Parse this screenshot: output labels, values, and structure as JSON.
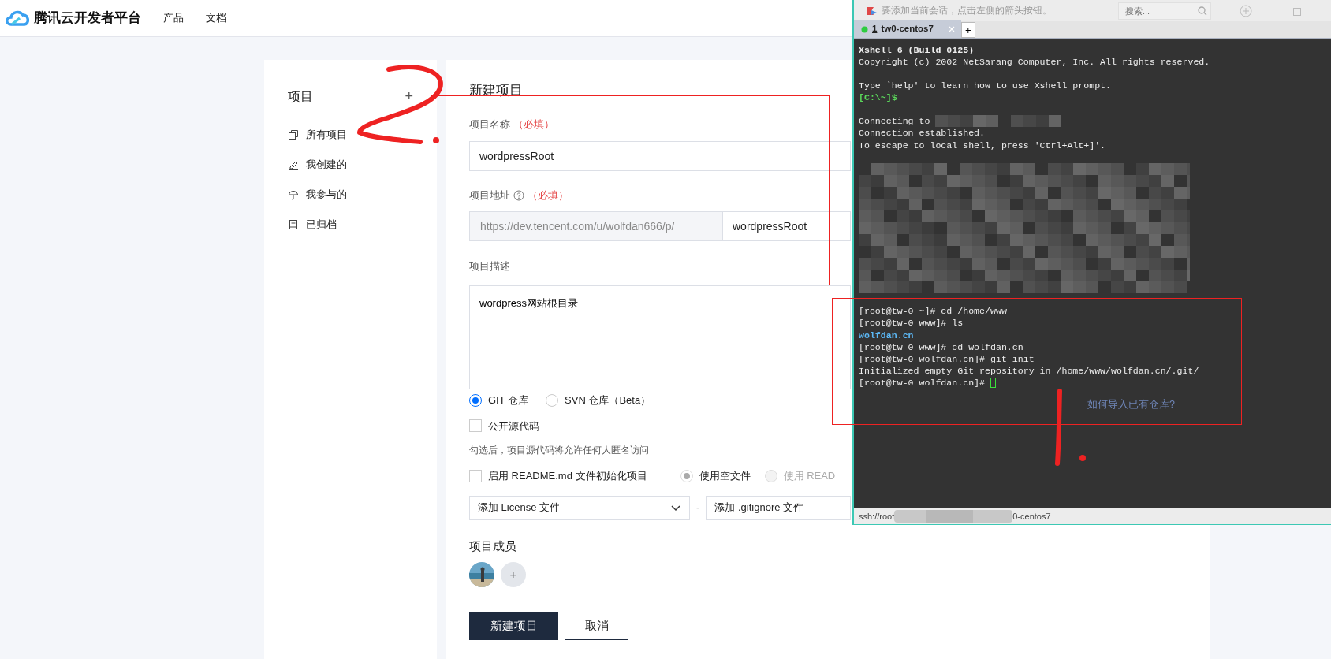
{
  "header": {
    "logo_text": "腾讯云开发者平台",
    "nav": [
      {
        "label": "产品"
      },
      {
        "label": "文档"
      }
    ]
  },
  "sidebar": {
    "title": "项目",
    "add": "+",
    "items": [
      {
        "label": "所有项目",
        "kind": "copy"
      },
      {
        "label": "我创建的",
        "kind": "pencil"
      },
      {
        "label": "我参与的",
        "kind": "umbrella"
      },
      {
        "label": "已归档",
        "kind": "archive"
      }
    ]
  },
  "form": {
    "title": "新建项目",
    "name_label": "项目名称",
    "name_required": "（必填）",
    "name_value": "wordpressRoot",
    "url_label": "项目地址",
    "url_required": "（必填）",
    "url_prefix": "https://dev.tencent.com/u/wolfdan666/p/",
    "url_value": "wordpressRoot",
    "desc_label": "项目描述",
    "desc_value": "wordpress网站根目录",
    "repo_types": [
      {
        "label": "GIT 仓库",
        "selected": true
      },
      {
        "label": "SVN 仓库（Beta）",
        "selected": false
      }
    ],
    "public": {
      "label": "公开源代码",
      "checked": false
    },
    "public_hint": "勾选后，项目源代码将允许任何人匿名访问",
    "readme": {
      "label": "启用 README.md 文件初始化项目",
      "checked": false
    },
    "readme_options": [
      {
        "label": "使用空文件",
        "selected": true,
        "disabled": false
      },
      {
        "label": "使用 READ",
        "selected": false,
        "disabled": true
      }
    ],
    "license_select": "添加 License 文件",
    "separator": "-",
    "gitignore_select": "添加 .gitignore 文件",
    "members_label": "项目成员",
    "add_member": "+",
    "buttons": [
      {
        "label": "新建项目",
        "kind": "primary"
      },
      {
        "label": "取消",
        "kind": "secondary"
      }
    ]
  },
  "xshell": {
    "hint": "要添加当前会话，点击左侧的箭头按钮。",
    "search_placeholder": "搜索...",
    "tabs": [
      {
        "number": "1",
        "label": "tw0-centos7",
        "selected": true
      }
    ],
    "new_tab": "+",
    "lines": [
      {
        "kind": "heading",
        "text": "Xshell 6 (Build 0125)"
      },
      {
        "kind": "text",
        "text": "Copyright (c) 2002 NetSarang Computer, Inc. All rights reserved."
      },
      {
        "kind": "blank"
      },
      {
        "kind": "text",
        "text": "Type `help' to learn how to use Xshell prompt."
      },
      {
        "kind": "prompt",
        "text": "[C:\\~]$"
      },
      {
        "kind": "blank"
      },
      {
        "kind": "text_redacted",
        "text": "Connecting to"
      },
      {
        "kind": "text",
        "text": "Connection established."
      },
      {
        "kind": "text",
        "text": "To escape to local shell, press 'Ctrl+Alt+]'."
      },
      {
        "kind": "blank"
      },
      {
        "kind": "redacted"
      },
      {
        "kind": "text",
        "text": "[root@tw-0 ~]# cd /home/www"
      },
      {
        "kind": "text",
        "text": "[root@tw-0 www]# ls"
      },
      {
        "kind": "dir",
        "text": "wolfdan.cn"
      },
      {
        "kind": "text",
        "text": "[root@tw-0 www]# cd wolfdan.cn"
      },
      {
        "kind": "text",
        "text": "[root@tw-0 wolfdan.cn]# git init"
      },
      {
        "kind": "text",
        "text": "Initialized empty Git repository in /home/www/wolfdan.cn/.git/"
      },
      {
        "kind": "input",
        "text": "[root@tw-0 wolfdan.cn]#"
      }
    ],
    "underlying_link": "如何导入已有仓库?",
    "status_left": "ssh://root",
    "status_right": "0-centos7"
  }
}
